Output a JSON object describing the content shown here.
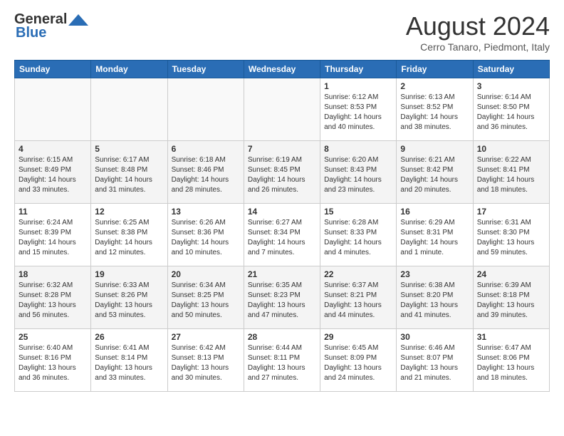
{
  "logo": {
    "line1": "General",
    "line2": "Blue"
  },
  "title": "August 2024",
  "subtitle": "Cerro Tanaro, Piedmont, Italy",
  "days_of_week": [
    "Sunday",
    "Monday",
    "Tuesday",
    "Wednesday",
    "Thursday",
    "Friday",
    "Saturday"
  ],
  "weeks": [
    {
      "alt": false,
      "days": [
        {
          "num": "",
          "info": ""
        },
        {
          "num": "",
          "info": ""
        },
        {
          "num": "",
          "info": ""
        },
        {
          "num": "",
          "info": ""
        },
        {
          "num": "1",
          "info": "Sunrise: 6:12 AM\nSunset: 8:53 PM\nDaylight: 14 hours\nand 40 minutes."
        },
        {
          "num": "2",
          "info": "Sunrise: 6:13 AM\nSunset: 8:52 PM\nDaylight: 14 hours\nand 38 minutes."
        },
        {
          "num": "3",
          "info": "Sunrise: 6:14 AM\nSunset: 8:50 PM\nDaylight: 14 hours\nand 36 minutes."
        }
      ]
    },
    {
      "alt": true,
      "days": [
        {
          "num": "4",
          "info": "Sunrise: 6:15 AM\nSunset: 8:49 PM\nDaylight: 14 hours\nand 33 minutes."
        },
        {
          "num": "5",
          "info": "Sunrise: 6:17 AM\nSunset: 8:48 PM\nDaylight: 14 hours\nand 31 minutes."
        },
        {
          "num": "6",
          "info": "Sunrise: 6:18 AM\nSunset: 8:46 PM\nDaylight: 14 hours\nand 28 minutes."
        },
        {
          "num": "7",
          "info": "Sunrise: 6:19 AM\nSunset: 8:45 PM\nDaylight: 14 hours\nand 26 minutes."
        },
        {
          "num": "8",
          "info": "Sunrise: 6:20 AM\nSunset: 8:43 PM\nDaylight: 14 hours\nand 23 minutes."
        },
        {
          "num": "9",
          "info": "Sunrise: 6:21 AM\nSunset: 8:42 PM\nDaylight: 14 hours\nand 20 minutes."
        },
        {
          "num": "10",
          "info": "Sunrise: 6:22 AM\nSunset: 8:41 PM\nDaylight: 14 hours\nand 18 minutes."
        }
      ]
    },
    {
      "alt": false,
      "days": [
        {
          "num": "11",
          "info": "Sunrise: 6:24 AM\nSunset: 8:39 PM\nDaylight: 14 hours\nand 15 minutes."
        },
        {
          "num": "12",
          "info": "Sunrise: 6:25 AM\nSunset: 8:38 PM\nDaylight: 14 hours\nand 12 minutes."
        },
        {
          "num": "13",
          "info": "Sunrise: 6:26 AM\nSunset: 8:36 PM\nDaylight: 14 hours\nand 10 minutes."
        },
        {
          "num": "14",
          "info": "Sunrise: 6:27 AM\nSunset: 8:34 PM\nDaylight: 14 hours\nand 7 minutes."
        },
        {
          "num": "15",
          "info": "Sunrise: 6:28 AM\nSunset: 8:33 PM\nDaylight: 14 hours\nand 4 minutes."
        },
        {
          "num": "16",
          "info": "Sunrise: 6:29 AM\nSunset: 8:31 PM\nDaylight: 14 hours\nand 1 minute."
        },
        {
          "num": "17",
          "info": "Sunrise: 6:31 AM\nSunset: 8:30 PM\nDaylight: 13 hours\nand 59 minutes."
        }
      ]
    },
    {
      "alt": true,
      "days": [
        {
          "num": "18",
          "info": "Sunrise: 6:32 AM\nSunset: 8:28 PM\nDaylight: 13 hours\nand 56 minutes."
        },
        {
          "num": "19",
          "info": "Sunrise: 6:33 AM\nSunset: 8:26 PM\nDaylight: 13 hours\nand 53 minutes."
        },
        {
          "num": "20",
          "info": "Sunrise: 6:34 AM\nSunset: 8:25 PM\nDaylight: 13 hours\nand 50 minutes."
        },
        {
          "num": "21",
          "info": "Sunrise: 6:35 AM\nSunset: 8:23 PM\nDaylight: 13 hours\nand 47 minutes."
        },
        {
          "num": "22",
          "info": "Sunrise: 6:37 AM\nSunset: 8:21 PM\nDaylight: 13 hours\nand 44 minutes."
        },
        {
          "num": "23",
          "info": "Sunrise: 6:38 AM\nSunset: 8:20 PM\nDaylight: 13 hours\nand 41 minutes."
        },
        {
          "num": "24",
          "info": "Sunrise: 6:39 AM\nSunset: 8:18 PM\nDaylight: 13 hours\nand 39 minutes."
        }
      ]
    },
    {
      "alt": false,
      "days": [
        {
          "num": "25",
          "info": "Sunrise: 6:40 AM\nSunset: 8:16 PM\nDaylight: 13 hours\nand 36 minutes."
        },
        {
          "num": "26",
          "info": "Sunrise: 6:41 AM\nSunset: 8:14 PM\nDaylight: 13 hours\nand 33 minutes."
        },
        {
          "num": "27",
          "info": "Sunrise: 6:42 AM\nSunset: 8:13 PM\nDaylight: 13 hours\nand 30 minutes."
        },
        {
          "num": "28",
          "info": "Sunrise: 6:44 AM\nSunset: 8:11 PM\nDaylight: 13 hours\nand 27 minutes."
        },
        {
          "num": "29",
          "info": "Sunrise: 6:45 AM\nSunset: 8:09 PM\nDaylight: 13 hours\nand 24 minutes."
        },
        {
          "num": "30",
          "info": "Sunrise: 6:46 AM\nSunset: 8:07 PM\nDaylight: 13 hours\nand 21 minutes."
        },
        {
          "num": "31",
          "info": "Sunrise: 6:47 AM\nSunset: 8:06 PM\nDaylight: 13 hours\nand 18 minutes."
        }
      ]
    }
  ]
}
